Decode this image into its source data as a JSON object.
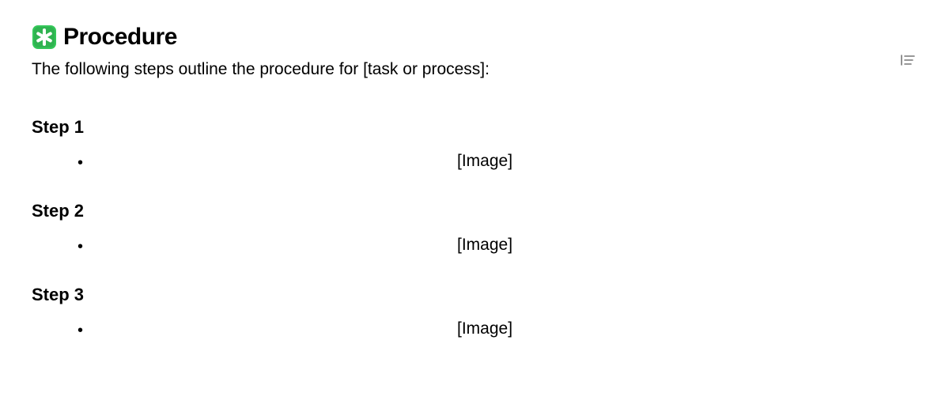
{
  "heading": {
    "icon_name": "asterisk-badge-icon",
    "text": "Procedure"
  },
  "intro": "The following steps outline the procedure for [task or process]:",
  "steps": [
    {
      "title": "Step 1",
      "image_placeholder": "[Image]"
    },
    {
      "title": "Step 2",
      "image_placeholder": "[Image]"
    },
    {
      "title": "Step 3",
      "image_placeholder": "[Image]"
    }
  ],
  "toc_button": {
    "label": "Table of contents"
  }
}
